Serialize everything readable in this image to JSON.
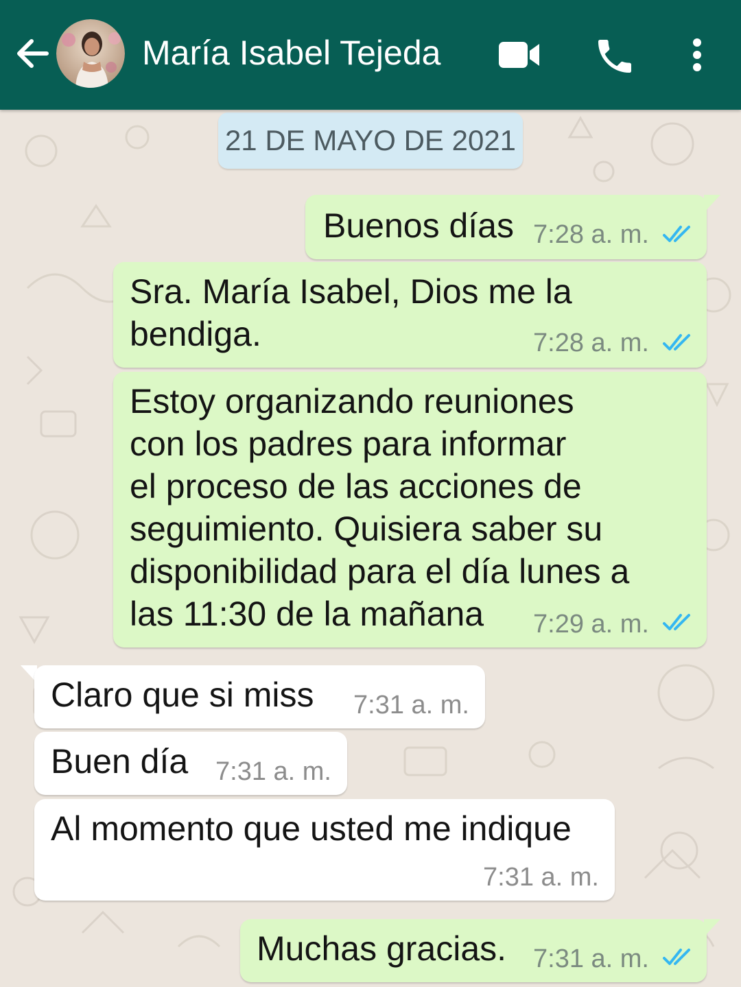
{
  "header": {
    "contact_name": "María Isabel Tejeda",
    "background_color": "#075E54",
    "icons": [
      "back-arrow-icon",
      "avatar",
      "video-call-icon",
      "phone-call-icon",
      "more-options-icon"
    ]
  },
  "chat": {
    "date_label": "21 DE MAYO DE 2021",
    "messages": [
      {
        "direction": "outgoing",
        "lines": [
          "Buenos días"
        ],
        "time": "7:28 a. m.",
        "status": "read"
      },
      {
        "direction": "outgoing",
        "lines": [
          "Sra. María Isabel, Dios me la",
          "bendiga."
        ],
        "time": "7:28 a. m.",
        "status": "read"
      },
      {
        "direction": "outgoing",
        "lines": [
          "Estoy organizando reuniones",
          "con los padres para informar",
          "el proceso de las acciones de",
          "seguimiento. Quisiera saber su",
          "disponibilidad para el día lunes a",
          "las 11:30 de la mañana"
        ],
        "time": "7:29 a. m.",
        "status": "read"
      },
      {
        "direction": "incoming",
        "lines": [
          "Claro que si miss"
        ],
        "time": "7:31 a. m."
      },
      {
        "direction": "incoming",
        "lines": [
          "Buen día"
        ],
        "time": "7:31 a. m."
      },
      {
        "direction": "incoming",
        "lines": [
          "Al momento que usted me indique"
        ],
        "time": "7:31 a. m."
      },
      {
        "direction": "outgoing",
        "lines": [
          "Muchas gracias."
        ],
        "time": "7:31 a. m.",
        "status": "read"
      }
    ]
  },
  "colors": {
    "outgoing_bubble": "#DCF8C6",
    "incoming_bubble": "#FFFFFF",
    "date_chip": "#D4EAF4",
    "read_ticks": "#34B7F1",
    "wallpaper": "#ECE5DD"
  }
}
